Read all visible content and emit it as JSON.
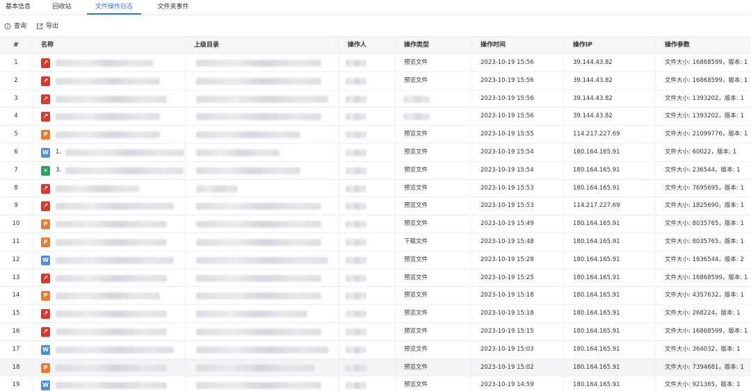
{
  "tabs": [
    {
      "label": "基本信息"
    },
    {
      "label": "回收站"
    },
    {
      "label": "文件操作日志",
      "active": true
    },
    {
      "label": "文件夹事件"
    }
  ],
  "toolbar": {
    "query_label": "查询",
    "export_label": "导出"
  },
  "table": {
    "columns": [
      "#",
      "名称",
      "上级目录",
      "操作人",
      "操作类型",
      "操作时间",
      "操作IP",
      "操作参数"
    ],
    "rows": [
      {
        "index": "1",
        "file_type": "pdf",
        "name": "",
        "op_type": "预览文件",
        "time": "2023-10-19 15:56",
        "ip": "39.144.43.82",
        "params": "文件大小: 16868599，版本: 1"
      },
      {
        "index": "2",
        "file_type": "pdf",
        "name": "",
        "op_type": "预览文件",
        "time": "2023-10-19 15:56",
        "ip": "39.144.43.82",
        "params": "文件大小: 16868599，版本: 1"
      },
      {
        "index": "3",
        "file_type": "pdf",
        "name": "",
        "op_type": "",
        "time": "2023-10-19 15:56",
        "ip": "39.144.43.82",
        "params": "文件大小: 1393202，版本: 1"
      },
      {
        "index": "4",
        "file_type": "pdf",
        "name": "",
        "op_type": "",
        "time": "2023-10-19 15:56",
        "ip": "39.144.43.82",
        "params": "文件大小: 1393202，版本: 1"
      },
      {
        "index": "5",
        "file_type": "ppt",
        "name": "",
        "op_type": "预览文件",
        "time": "2023-10-19 15:55",
        "ip": "114.217.227.69",
        "params": "文件大小: 21099776，版本: 1"
      },
      {
        "index": "6",
        "file_type": "doc",
        "name": "1.",
        "op_type": "预览文件",
        "time": "2023-10-19 15:54",
        "ip": "180.164.165.91",
        "params": "文件大小: 60022，版本: 1"
      },
      {
        "index": "7",
        "file_type": "xls",
        "name": "3.",
        "op_type": "预览文件",
        "time": "2023-10-19 15:54",
        "ip": "180.164.165.91",
        "params": "文件大小: 236544，版本: 1"
      },
      {
        "index": "8",
        "file_type": "pdf",
        "name": "",
        "op_type": "预览文件",
        "time": "2023-10-19 15:53",
        "ip": "180.164.165.91",
        "params": "文件大小: 7695695，版本: 1"
      },
      {
        "index": "9",
        "file_type": "pdf",
        "name": "",
        "op_type": "预览文件",
        "time": "2023-10-19 15:53",
        "ip": "114.217.227.69",
        "params": "文件大小: 1825690，版本: 1"
      },
      {
        "index": "10",
        "file_type": "ppt",
        "name": "",
        "op_type": "预览文件",
        "time": "2023-10-19 15:49",
        "ip": "180.164.165.91",
        "params": "文件大小: 8035765，版本: 1"
      },
      {
        "index": "11",
        "file_type": "ppt",
        "name": "",
        "op_type": "下载文件",
        "time": "2023-10-19 15:48",
        "ip": "180.164.165.91",
        "params": "文件大小: 8035765，版本: 1"
      },
      {
        "index": "12",
        "file_type": "doc",
        "name": "",
        "op_type": "预览文件",
        "time": "2023-10-19 15:28",
        "ip": "180.164.165.91",
        "params": "文件大小: 1836544，版本: 2"
      },
      {
        "index": "13",
        "file_type": "pdf",
        "name": "",
        "op_type": "预览文件",
        "time": "2023-10-19 15:25",
        "ip": "180.164.165.91",
        "params": "文件大小: 16868599，版本: 1"
      },
      {
        "index": "14",
        "file_type": "ppt",
        "name": "",
        "op_type": "预览文件",
        "time": "2023-10-19 15:18",
        "ip": "180.164.165.91",
        "params": "文件大小: 4357632，版本: 1"
      },
      {
        "index": "15",
        "file_type": "pdf",
        "name": "",
        "op_type": "预览文件",
        "time": "2023-10-19 15:18",
        "ip": "180.164.165.91",
        "params": "文件大小: 268224，版本: 1"
      },
      {
        "index": "16",
        "file_type": "pdf",
        "name": "",
        "op_type": "预览文件",
        "time": "2023-10-19 15:15",
        "ip": "180.164.165.91",
        "params": "文件大小: 16868599，版本: 1"
      },
      {
        "index": "17",
        "file_type": "doc",
        "name": "",
        "op_type": "预览文件",
        "time": "2023-10-19 15:03",
        "ip": "180.164.165.91",
        "params": "文件大小: 364032，版本: 1"
      },
      {
        "index": "18",
        "file_type": "ppt",
        "name": "",
        "op_type": "预览文件",
        "time": "2023-10-19 15:02",
        "ip": "180.164.165.91",
        "params": "文件大小: 7394681，版本: 1",
        "highlighted": true
      },
      {
        "index": "19",
        "file_type": "doc",
        "name": "",
        "op_type": "预览文件",
        "time": "2023-10-19 14:59",
        "ip": "180.164.165.91",
        "params": "文件大小: 921365，版本: 1"
      }
    ]
  },
  "colors": {
    "accent": "#2f73e6",
    "pdf": "#e0352b",
    "ppt": "#f0782a",
    "doc": "#4a90e2",
    "xls": "#2aa35a"
  }
}
